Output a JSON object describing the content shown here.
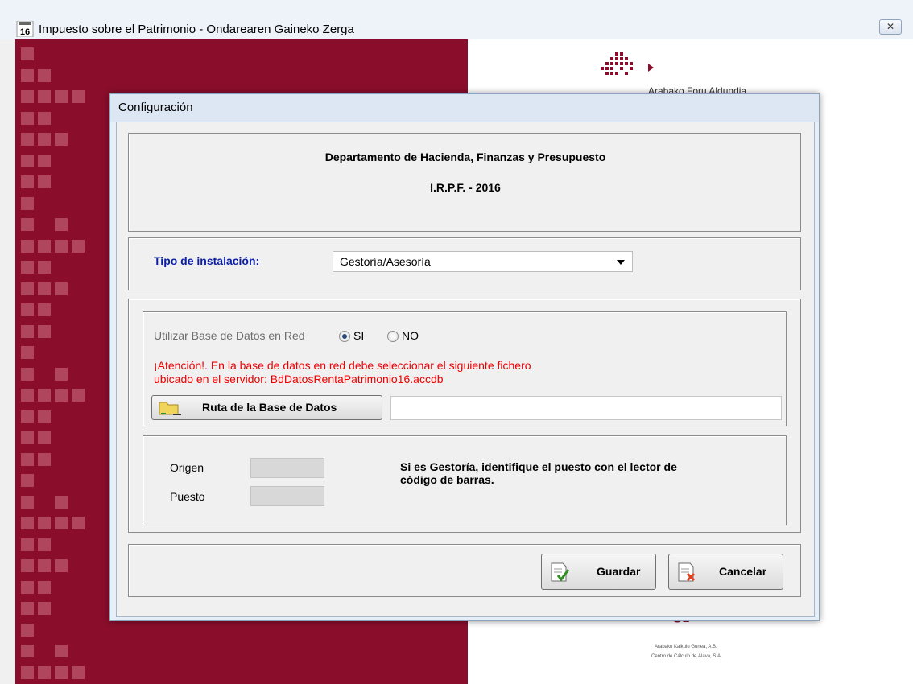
{
  "window": {
    "title": "Impuesto sobre el Patrimonio - Ondarearen Gaineko Zerga",
    "app_icon_label": "16",
    "close_glyph": "✕"
  },
  "background": {
    "org_name": "Arabako Foru Aldundia",
    "footer_line1": "Arabako Kalkulu Gunea, A.B.",
    "footer_line2": "Centro de Cálculo de Álava, S.A.",
    "footer_logo": "a",
    "brand_color": "#8a0d2c"
  },
  "dialog": {
    "title": "Configuración",
    "header": {
      "department": "Departamento de Hacienda, Finanzas y Presupuesto",
      "subtitle": "I.R.P.F. - 2016"
    },
    "install": {
      "label": "Tipo de instalación:",
      "value": "Gestoría/Asesoría"
    },
    "network": {
      "label": "Utilizar Base de Datos en Red",
      "options": [
        {
          "label": "SI",
          "selected": true
        },
        {
          "label": "NO",
          "selected": false
        }
      ],
      "warning_line1": "¡Atención!. En la base de datos en red debe seleccionar el siguiente fichero",
      "warning_line2": "ubicado en el servidor: BdDatosRentaPatrimonio16.accdb",
      "path_button": "Ruta de la Base de Datos",
      "path_value": ""
    },
    "station": {
      "origin_label": "Origen",
      "post_label": "Puesto",
      "origin_value": "",
      "post_value": "",
      "hint_line1": "Si es Gestoría, identifique el puesto con el lector de",
      "hint_line2": "código de barras."
    },
    "buttons": {
      "save": "Guardar",
      "cancel": "Cancelar"
    }
  }
}
